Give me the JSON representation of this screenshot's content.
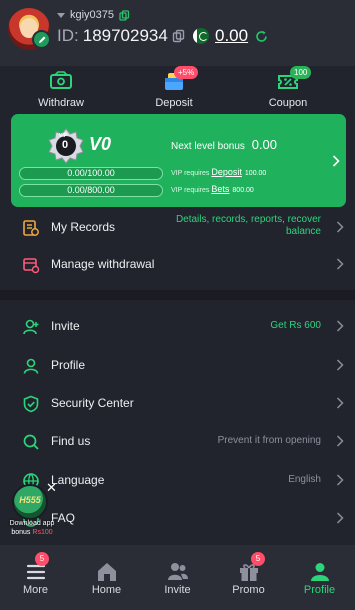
{
  "user": {
    "username": "kgiy0375",
    "id_label": "ID:",
    "id": "189702934",
    "balance": "0.00"
  },
  "actions": [
    {
      "label": "Withdraw"
    },
    {
      "label": "Deposit",
      "badge": "+5%"
    },
    {
      "label": "Coupon",
      "badge": "100"
    }
  ],
  "vip": {
    "emblem_text": "VIP",
    "emblem_level": "0",
    "level": "V0",
    "next_bonus_label": "Next level bonus",
    "next_bonus_value": "0.00",
    "deposit_progress": "0.00/100.00",
    "bets_progress": "0.00/800.00",
    "deposit_req_prefix": "VIP requires",
    "deposit_req_link": "Deposit",
    "deposit_req_amount": "100.00",
    "bets_req_prefix": "VIP requires",
    "bets_req_link": "Bets",
    "bets_req_amount": "800.00"
  },
  "records_menu": [
    {
      "label": "My Records",
      "value": "Details, records, reports, recover balance"
    },
    {
      "label": "Manage withdrawal",
      "value": ""
    }
  ],
  "settings_menu": [
    {
      "label": "Invite",
      "value": "Get Rs 600"
    },
    {
      "label": "Profile",
      "value": ""
    },
    {
      "label": "Security Center",
      "value": ""
    },
    {
      "label": "Find us",
      "value": "Prevent it from opening"
    },
    {
      "label": "Language",
      "value": "English"
    },
    {
      "label": "FAQ",
      "value": ""
    }
  ],
  "float_promo": {
    "logo_text": "H555",
    "caption_line1": "Download app",
    "caption_line2_prefix": "bonus",
    "caption_line2_amount": "Rs100"
  },
  "nav": [
    {
      "label": "More",
      "badge": "5"
    },
    {
      "label": "Home"
    },
    {
      "label": "Invite"
    },
    {
      "label": "Promo",
      "badge": "5"
    },
    {
      "label": "Profile",
      "active": true
    }
  ],
  "colors": {
    "accent": "#20b15c",
    "active_text": "#2bd67b",
    "background": "#22242d",
    "badge": "#ff4d6a"
  }
}
